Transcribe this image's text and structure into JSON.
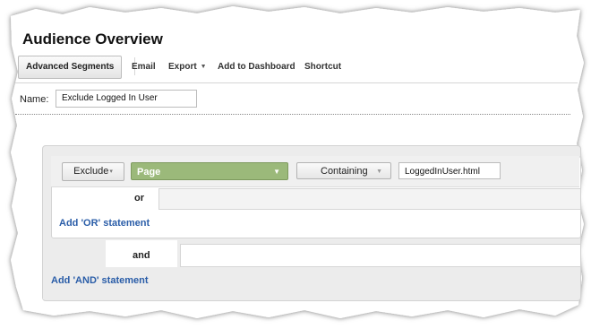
{
  "page": {
    "title": "Audience Overview"
  },
  "toolbar": {
    "advanced_segments": "Advanced Segments",
    "email": "Email",
    "export": "Export",
    "add_to_dashboard": "Add to Dashboard",
    "shortcut": "Shortcut"
  },
  "segment": {
    "name_label": "Name:",
    "name_value": "Exclude Logged In User"
  },
  "condition": {
    "include_exclude": "Exclude",
    "dimension": "Page",
    "match_type": "Containing",
    "value": "LoggedInUser.html"
  },
  "logic": {
    "or_label": "or",
    "add_or": "Add 'OR' statement",
    "and_label": "and",
    "add_and": "Add 'AND' statement"
  },
  "icons": {
    "dropdown": "chevron-down-icon"
  },
  "colors": {
    "dimension_select": "#9bb97a",
    "link": "#2a5da8"
  }
}
